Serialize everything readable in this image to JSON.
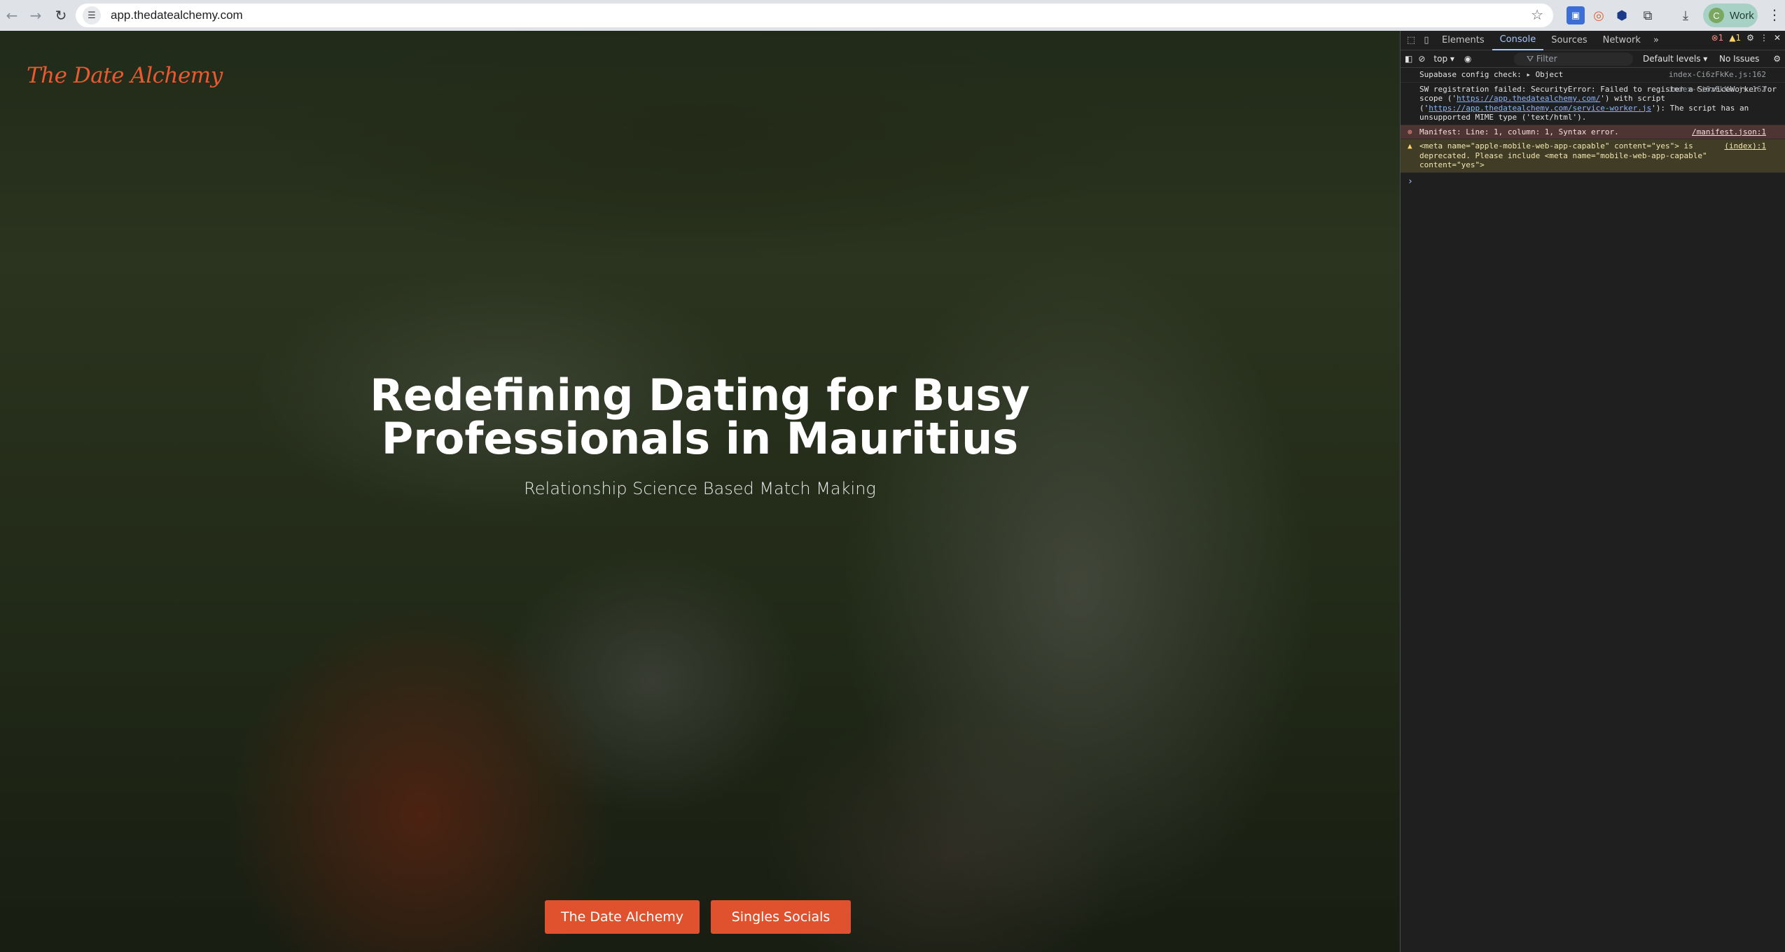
{
  "browser": {
    "url": "app.thedatealchemy.com",
    "profile_initial": "C",
    "profile_label": "Work"
  },
  "site": {
    "logo": "The Date Alchemy",
    "hero_title_line1": "Redefining Dating for Busy",
    "hero_title_line2": "Professionals in Mauritius",
    "hero_subtitle": "Relationship Science Based Match Making",
    "buttons": [
      "The Date Alchemy",
      "Singles Socials"
    ],
    "accent_color": "#e0522d"
  },
  "devtools": {
    "tabs": [
      "Elements",
      "Console",
      "Sources",
      "Network"
    ],
    "active_tab": "Console",
    "error_count": "1",
    "warning_count": "1",
    "context": "top",
    "filter_placeholder": "Filter",
    "levels": "Default levels",
    "issues": "No Issues",
    "messages": [
      {
        "type": "info",
        "text": "Supabase config check:  ▸ Object",
        "source": "index-Ci6zFkKe.js:162"
      },
      {
        "type": "info",
        "text_a": "SW registration failed: SecurityError: Failed to register a ServiceWorker for scope ('",
        "link_a": "https://app.thedatealchemy.com/",
        "text_b": "') with script ('",
        "link_b": "https://app.thedatealchemy.com/service-worker.js",
        "text_c": "'): The script has an unsupported MIME type ('text/html').",
        "source": "index-Ci6zFkKe.js:162"
      },
      {
        "type": "error",
        "text": "Manifest: Line: 1, column: 1, Syntax error.",
        "source": "/manifest.json:1"
      },
      {
        "type": "warning",
        "text": "<meta name=\"apple-mobile-web-app-capable\" content=\"yes\"> is deprecated. Please include <meta name=\"mobile-web-app-capable\" content=\"yes\">",
        "source": "(index):1"
      }
    ]
  }
}
